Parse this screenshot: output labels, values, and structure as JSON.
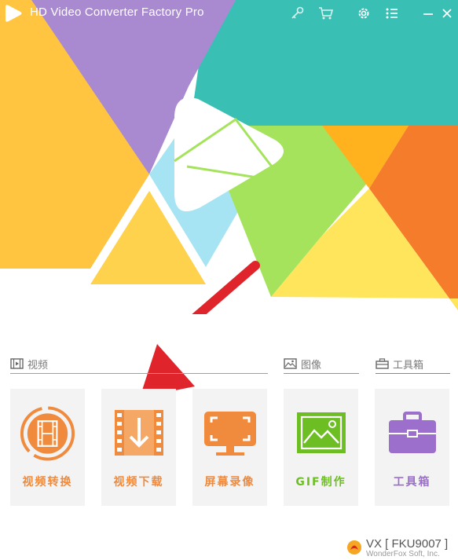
{
  "window": {
    "title": "HD Video Converter Factory Pro"
  },
  "toolbar": {
    "icons": [
      "key-icon",
      "cart-icon",
      "gear-icon",
      "menu-icon",
      "minimize-icon",
      "close-icon"
    ]
  },
  "sections": {
    "video": {
      "label": "视频",
      "icon": "film-strip-icon"
    },
    "image": {
      "label": "图像",
      "icon": "image-icon"
    },
    "tools": {
      "label": "工具箱",
      "icon": "toolbox-icon"
    }
  },
  "tiles": [
    {
      "label": "视频转换",
      "icon": "convert-film-icon",
      "color": "#F08A3C"
    },
    {
      "label": "视频下载",
      "icon": "download-film-icon",
      "color": "#F08A3C"
    },
    {
      "label": "屏幕录像",
      "icon": "screen-record-icon",
      "color": "#F08A3C"
    },
    {
      "label": "GIF制作",
      "icon": "gif-image-icon",
      "color": "#6DBE23"
    },
    {
      "label": "工具箱",
      "icon": "toolbox-icon",
      "color": "#9B6FCB"
    }
  ],
  "watermark": {
    "main": "VX [ FKU9007 ]",
    "sub": "WonderFox Soft, Inc."
  },
  "colors": {
    "video_accent": "#F08A3C",
    "image_accent": "#6DBE23",
    "tools_accent": "#9B6FCB",
    "tile_bg": "#F3F3F3",
    "annotation_arrow": "#E0242B"
  }
}
